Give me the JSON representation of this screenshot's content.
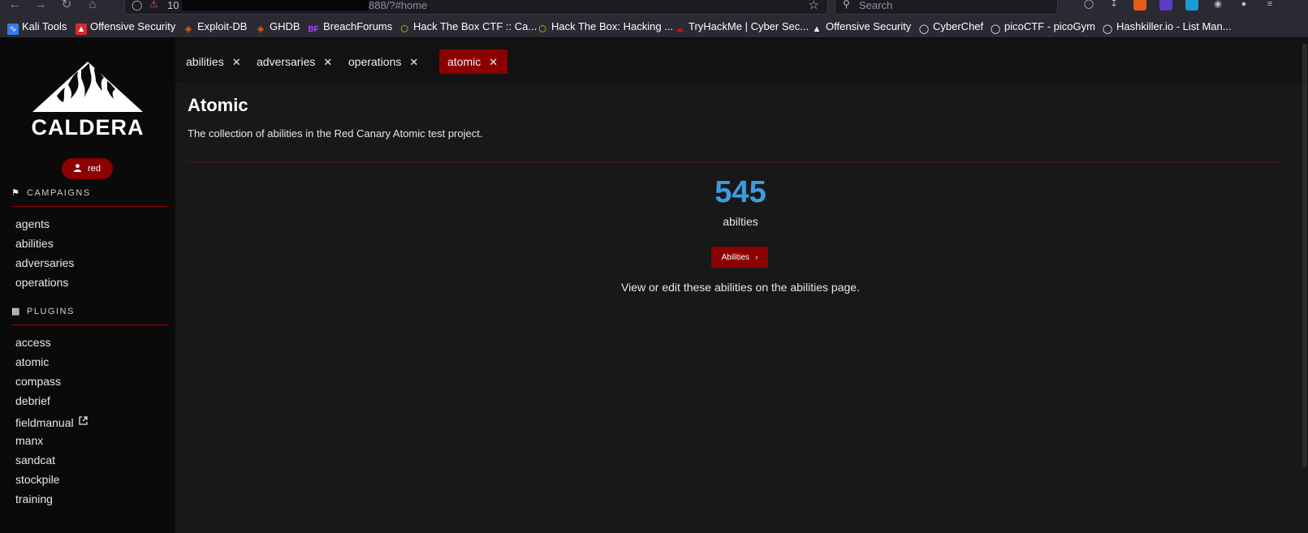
{
  "browser": {
    "url_prefix": "10",
    "url_suffix": "888/?#home",
    "search_placeholder": "Search"
  },
  "bookmarks": [
    {
      "label": "Kali Tools",
      "icon": "kali-dragon-icon",
      "color": "#367bf0"
    },
    {
      "label": "Offensive Security",
      "icon": "offsec-icon",
      "color": "#d72c2c"
    },
    {
      "label": "Exploit-DB",
      "icon": "exploitdb-icon",
      "color": "#e85d1f"
    },
    {
      "label": "GHDB",
      "icon": "ghdb-icon",
      "color": "#e85d1f"
    },
    {
      "label": "BreachForums",
      "icon": "bf-icon",
      "color": "#a64dff"
    },
    {
      "label": "Hack The Box CTF :: Ca...",
      "icon": "htb-cube-icon",
      "color": "#9fef00"
    },
    {
      "label": "Hack The Box: Hacking ...",
      "icon": "htb-cube-icon",
      "color": "#9fef00"
    },
    {
      "label": "TryHackMe | Cyber Sec...",
      "icon": "thm-icon",
      "color": "#c11111"
    },
    {
      "label": "Offensive Security",
      "icon": "offsec-white-icon",
      "color": "#ffffff"
    },
    {
      "label": "CyberChef",
      "icon": "globe-icon",
      "color": "#fbfbfe"
    },
    {
      "label": "picoCTF - picoGym",
      "icon": "globe-icon",
      "color": "#fbfbfe"
    },
    {
      "label": "Hashkiller.io - List Man...",
      "icon": "globe-icon",
      "color": "#fbfbfe"
    }
  ],
  "sidebar": {
    "logo_text": "CALDERA",
    "user": "red",
    "campaigns_header": "CAMPAIGNS",
    "campaigns": [
      "agents",
      "abilities",
      "adversaries",
      "operations"
    ],
    "plugins_header": "PLUGINS",
    "plugins": [
      "access",
      "atomic",
      "compass",
      "debrief",
      "fieldmanual",
      "manx",
      "sandcat",
      "stockpile",
      "training"
    ]
  },
  "tabs": [
    {
      "label": "abilities",
      "active": false
    },
    {
      "label": "adversaries",
      "active": false
    },
    {
      "label": "operations",
      "active": false
    },
    {
      "label": "atomic",
      "active": true
    }
  ],
  "main": {
    "title": "Atomic",
    "description": "The collection of abilities in the Red Canary Atomic test project.",
    "count": "545",
    "count_label": "abilties",
    "button_label": "Abilities",
    "view_text": "View or edit these abilities on the abilities page."
  },
  "colors": {
    "accent": "#8b0000",
    "count": "#3b9ddd",
    "sidebar_bg": "#0a0a0a",
    "content_bg": "#181818"
  }
}
